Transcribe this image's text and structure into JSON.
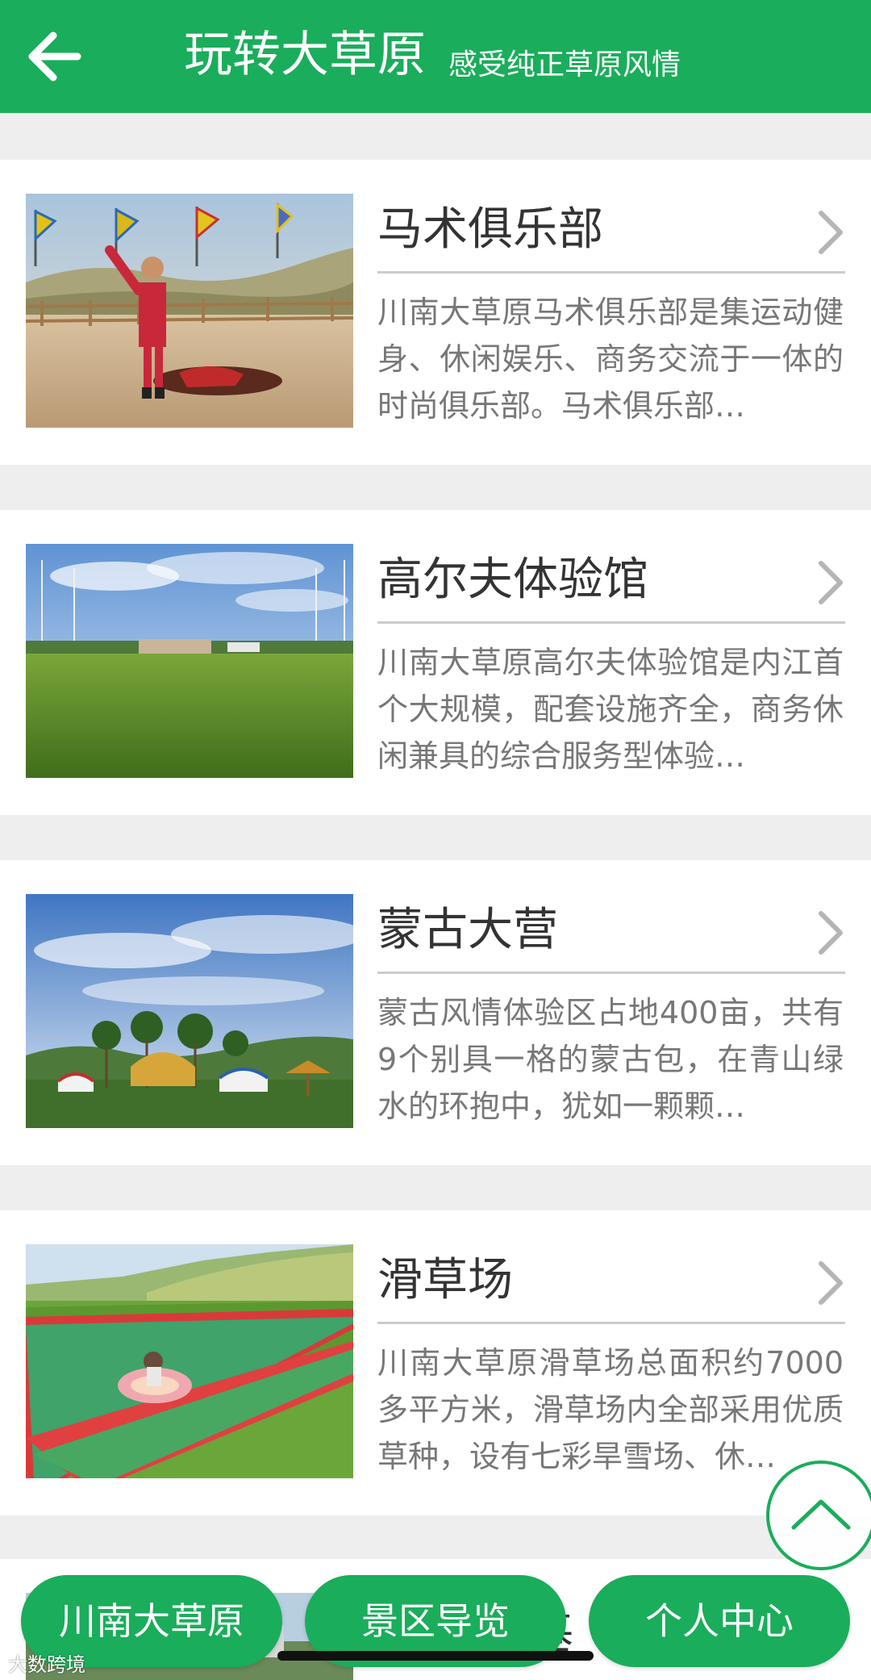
{
  "header": {
    "title": "玩转大草原",
    "subtitle": "感受纯正草原风情",
    "background_color": "#1aad5b"
  },
  "attractions": [
    {
      "title": "马术俱乐部",
      "description": "川南大草原马术俱乐部是集运动健身、休闲娱乐、商务交流于一体的时尚俱乐部。马术俱乐部…"
    },
    {
      "title": "高尔夫体验馆",
      "description": "川南大草原高尔夫体验馆是内江首个大规模，配套设施齐全，商务休闲兼具的综合服务型体验…"
    },
    {
      "title": "蒙古大营",
      "description": "蒙古风情体验区占地400亩，共有9个别具一格的蒙古包，在青山绿水的环抱中，犹如一颗颗…"
    },
    {
      "title": "滑草场",
      "description": "川南大草原滑草场总面积约7000多平方米，滑草场内全部采用优质草种，设有七彩旱雪场、休…"
    }
  ],
  "partial_item": {
    "title_visible": "基"
  },
  "bottom_nav": [
    {
      "label": "川南大草原"
    },
    {
      "label": "景区导览"
    },
    {
      "label": "个人中心"
    }
  ],
  "watermark": "大数跨境",
  "icons": {
    "back": "arrow-left-icon",
    "chevron": "chevron-right-icon",
    "scroll_top": "chevron-up-icon"
  }
}
